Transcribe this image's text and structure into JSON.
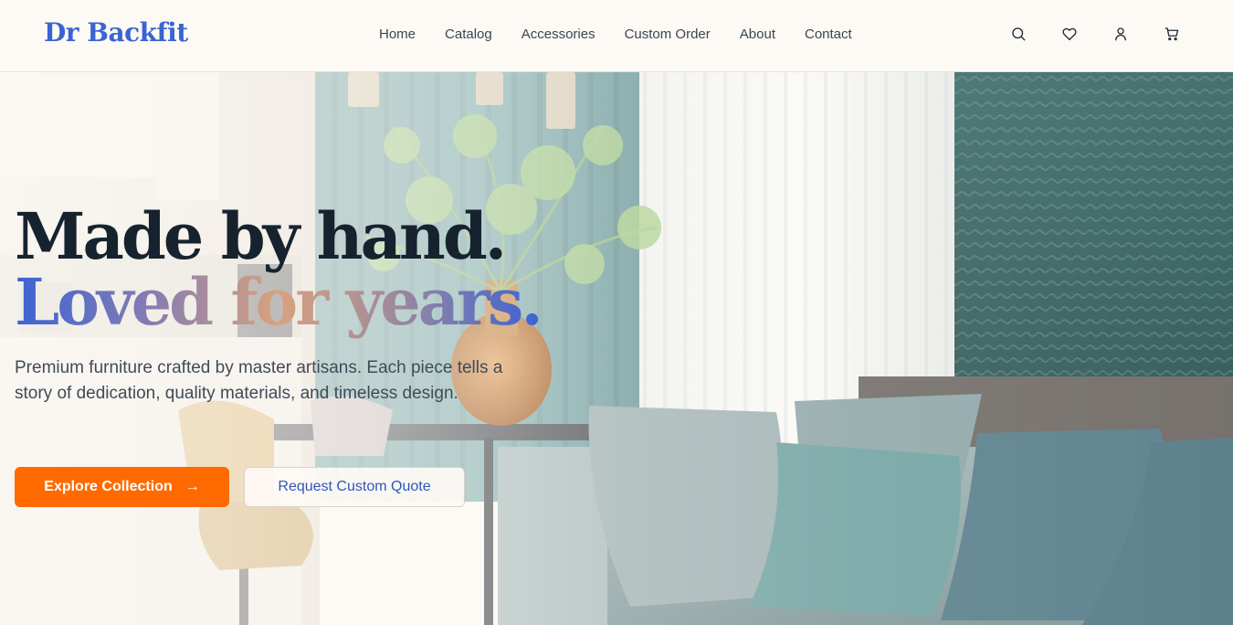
{
  "brand": {
    "name": "Dr Backfit",
    "color": "#3b63d4"
  },
  "nav": {
    "items": [
      {
        "label": "Home"
      },
      {
        "label": "Catalog"
      },
      {
        "label": "Accessories"
      },
      {
        "label": "Custom Order"
      },
      {
        "label": "About"
      },
      {
        "label": "Contact"
      }
    ]
  },
  "header_icons": [
    "search-icon",
    "heart-icon",
    "user-icon",
    "cart-icon"
  ],
  "hero": {
    "headline_line1": "Made by hand.",
    "headline_line2": "Loved for years.",
    "subtitle": "Premium furniture crafted by master artisans. Each piece tells a story of dedication, quality materials, and timeless design.",
    "primary_cta": "Explore Collection",
    "primary_cta_icon": "arrow-right-icon",
    "secondary_cta": "Request Custom Quote",
    "background_image": "living-room-photo"
  },
  "colors": {
    "accent": "#ff6a00",
    "brand_blue": "#3b63d4",
    "text_dark": "#16232f",
    "background": "#fdfaf5"
  }
}
